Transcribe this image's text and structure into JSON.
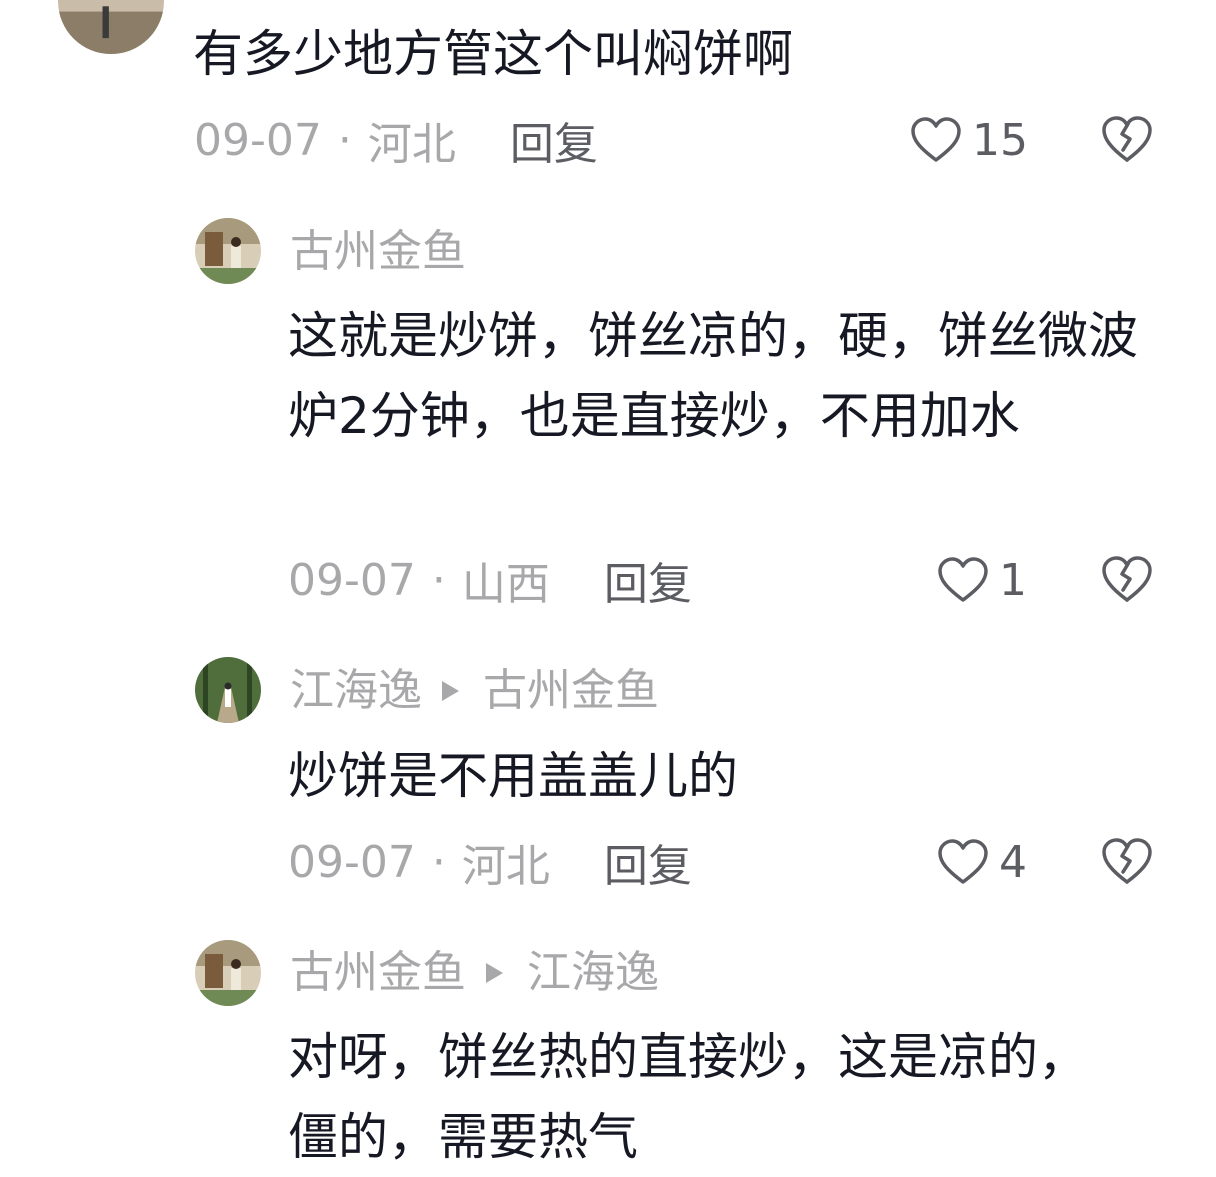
{
  "comments": [
    {
      "text": "有多少地方管这个叫焖饼啊",
      "date": "09-07",
      "separator": "·",
      "location": "河北",
      "reply_label": "回复",
      "likes": "15"
    },
    {
      "author": "古州金鱼",
      "text": "这就是炒饼，饼丝凉的，硬，饼丝微波炉2分钟，也是直接炒，不用加水",
      "date": "09-07",
      "separator": "·",
      "location": "山西",
      "reply_label": "回复",
      "likes": "1"
    },
    {
      "author": "江海逸",
      "reply_to": "古州金鱼",
      "text": "炒饼是不用盖盖儿的",
      "date": "09-07",
      "separator": "·",
      "location": "河北",
      "reply_label": "回复",
      "likes": "4"
    },
    {
      "author": "古州金鱼",
      "reply_to": "江海逸",
      "text": "对呀，饼丝热的直接炒，这是凉的，僵的，需要热气"
    }
  ],
  "icons": {
    "like": "heart-outline-icon",
    "dislike": "broken-heart-icon",
    "reply_to": "triangle-right-icon"
  },
  "colors": {
    "text_primary": "#161823",
    "text_secondary": "#a8a8ab",
    "action": "#5c5d63"
  }
}
